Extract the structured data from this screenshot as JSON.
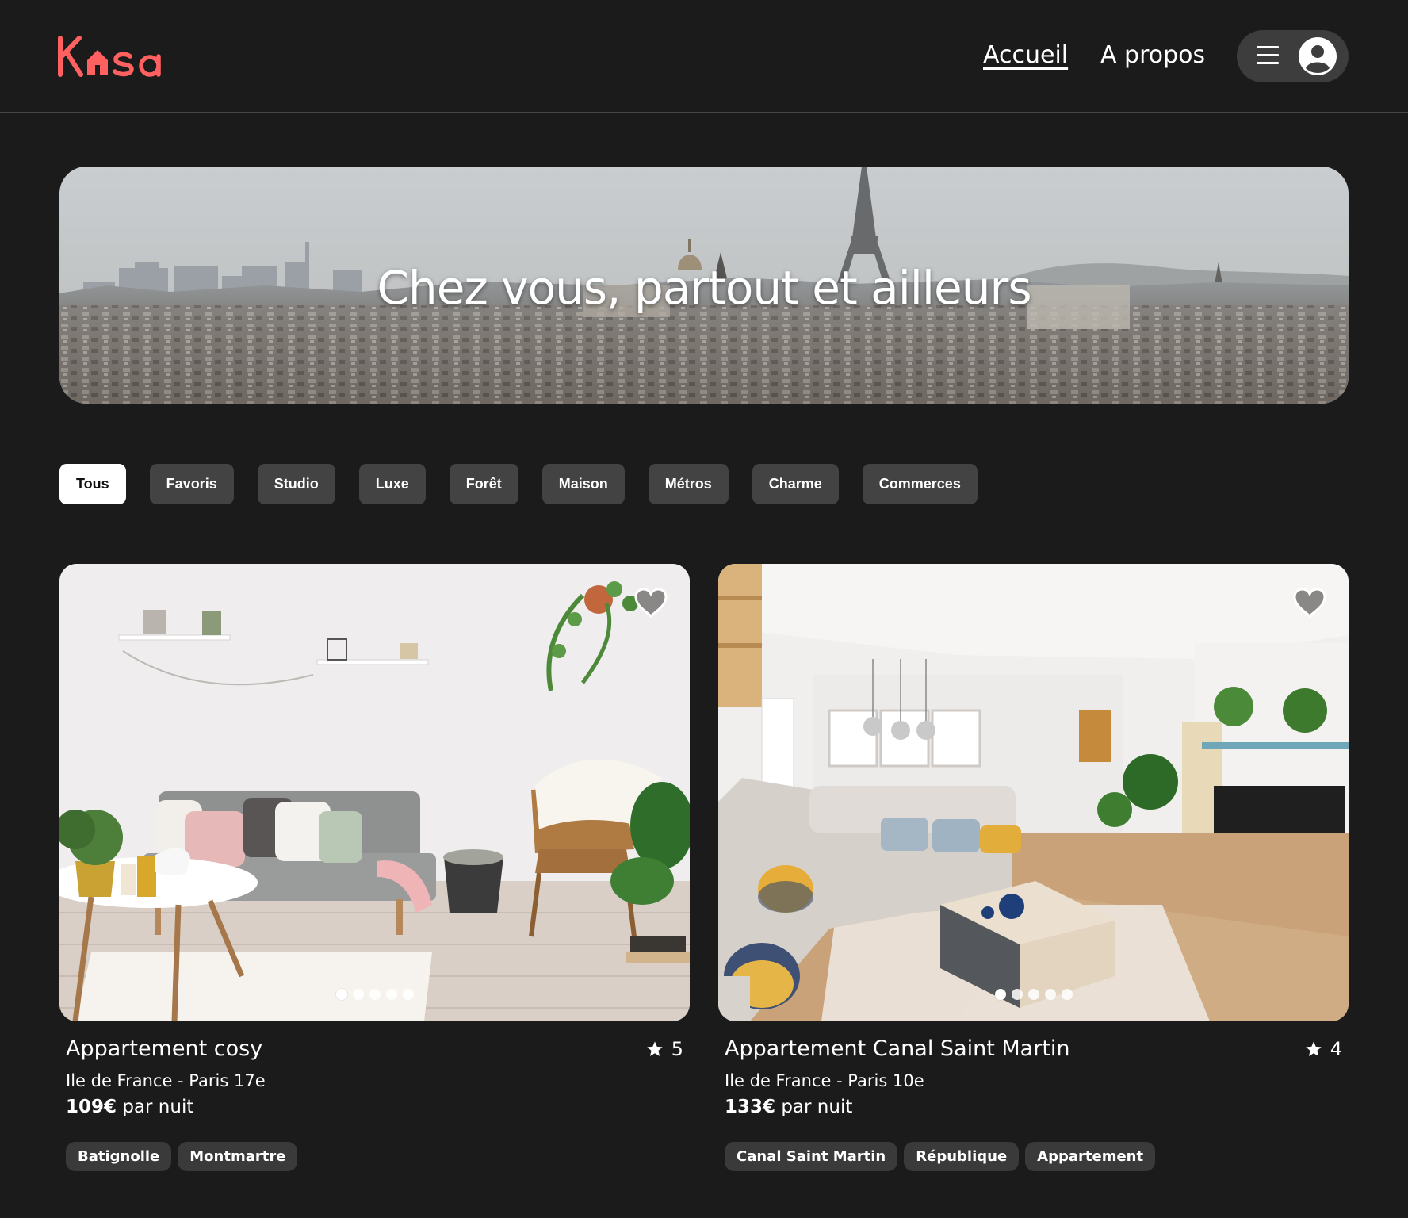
{
  "brand": {
    "logo_text": "Kasa",
    "accent_color": "#ff6060"
  },
  "nav": {
    "home": "Accueil",
    "about": "A propos",
    "menu_icon": "hamburger-icon",
    "user_icon": "user-avatar-icon"
  },
  "hero": {
    "title": "Chez vous, partout et ailleurs"
  },
  "filters": {
    "items": [
      "Tous",
      "Favoris",
      "Studio",
      "Luxe",
      "Forêt",
      "Maison",
      "Métros",
      "Charme",
      "Commerces"
    ],
    "active": "Tous"
  },
  "listings": [
    {
      "title": "Appartement cosy",
      "rating": "5",
      "location": "Ile de France - Paris 17e",
      "price": "109€",
      "price_suffix": " par nuit",
      "tags": [
        "Batignolle",
        "Montmartre"
      ],
      "photo_count": 5,
      "current_photo": 1
    },
    {
      "title": "Appartement Canal Saint Martin",
      "rating": "4",
      "location": "Ile de France - Paris 10e",
      "price": "133€",
      "price_suffix": " par nuit",
      "tags": [
        "Canal Saint Martin",
        "République",
        "Appartement"
      ],
      "photo_count": 5,
      "current_photo": 1
    }
  ]
}
